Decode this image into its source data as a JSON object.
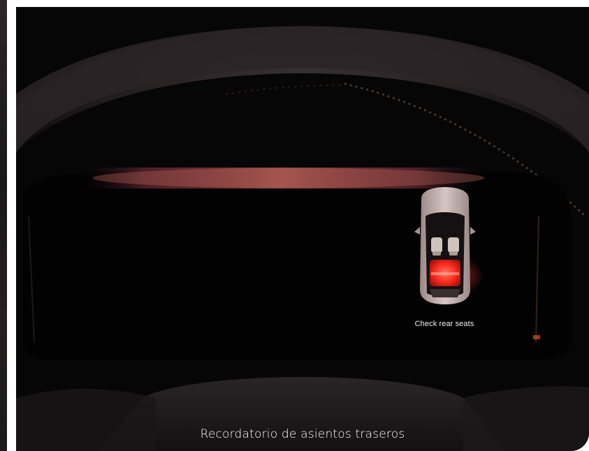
{
  "scene": {
    "subject": "Dashboard instrument cluster showing rear seat reminder",
    "accent_color": "#ff3b2f",
    "glow_color": "#b0424a"
  },
  "cluster": {
    "message": "Check rear seats",
    "icon": "car-top-view-icon"
  },
  "caption": {
    "text": "Recordatorio de asientos traseros"
  }
}
